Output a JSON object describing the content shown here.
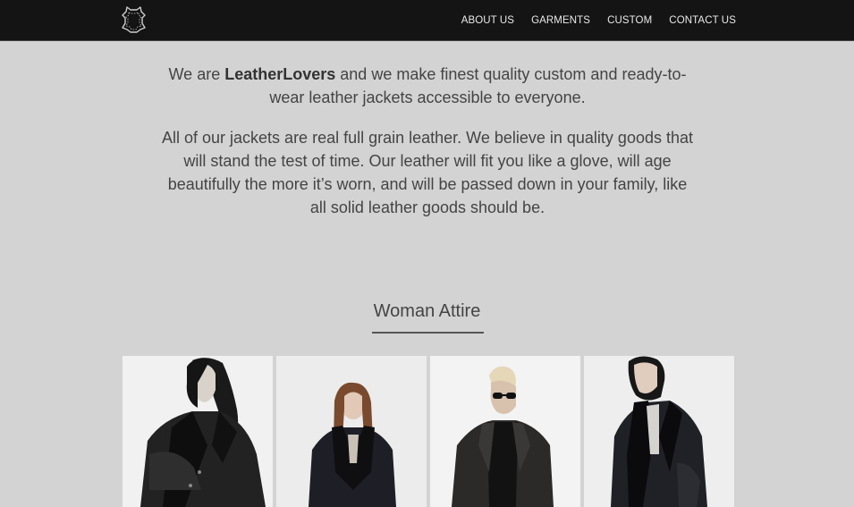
{
  "brand": {
    "logo_icon": "leather-hide-icon"
  },
  "nav": {
    "items": [
      {
        "label": "ABOUT US"
      },
      {
        "label": "GARMENTS"
      },
      {
        "label": "CUSTOM"
      },
      {
        "label": "CONTACT US"
      }
    ]
  },
  "intro": {
    "p1_before": "We are ",
    "p1_brand": "LeatherLovers",
    "p1_after": " and we make finest quality custom and ready-to-wear leather jackets accessible to everyone.",
    "p2": "All of our jackets are real full grain leather. We believe in quality goods that will stand the test of time. Our leather will fit you like a glove, will age beautifully the more it’s worn, and will be passed down in your family, like all solid leather goods should be."
  },
  "section": {
    "title": "Woman Attire"
  },
  "colors": {
    "navbar": "#141414",
    "page_background": "#d3d3d3",
    "text": "#444444"
  }
}
